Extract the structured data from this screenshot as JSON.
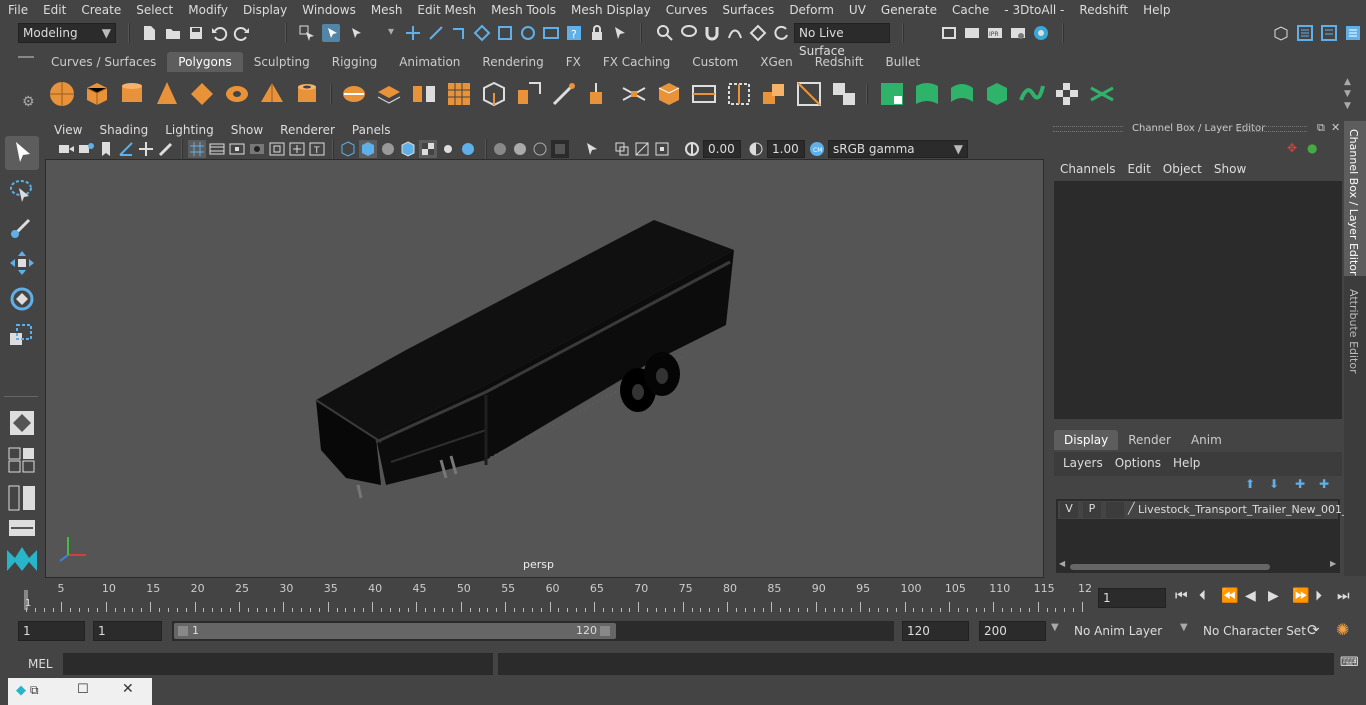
{
  "menubar": {
    "items": [
      "File",
      "Edit",
      "Create",
      "Select",
      "Modify",
      "Display",
      "Windows",
      "Mesh",
      "Edit Mesh",
      "Mesh Tools",
      "Mesh Display",
      "Curves",
      "Surfaces",
      "Deform",
      "UV",
      "Generate",
      "Cache",
      "- 3DtoAll -",
      "Redshift",
      "Help"
    ]
  },
  "status": {
    "mode": "Modeling",
    "live_surface": "No Live Surface"
  },
  "shelf": {
    "tabs": [
      "Curves / Surfaces",
      "Polygons",
      "Sculpting",
      "Rigging",
      "Animation",
      "Rendering",
      "FX",
      "FX Caching",
      "Custom",
      "XGen",
      "Redshift",
      "Bullet"
    ],
    "active_tab": "Polygons"
  },
  "viewport": {
    "menus": [
      "View",
      "Shading",
      "Lighting",
      "Show",
      "Renderer",
      "Panels"
    ],
    "exposure": "0.00",
    "gamma": "1.00",
    "color_space": "sRGB gamma",
    "camera_label": "persp"
  },
  "channel_box": {
    "title": "Channel Box / Layer Editor",
    "menus": [
      "Channels",
      "Edit",
      "Object",
      "Show"
    ],
    "layer_tabs": [
      "Display",
      "Render",
      "Anim"
    ],
    "active_layer_tab": "Display",
    "layer_menus": [
      "Layers",
      "Options",
      "Help"
    ],
    "layer": {
      "v": "V",
      "p": "P",
      "name": "Livestock_Transport_Trailer_New_001_"
    }
  },
  "side_tabs": [
    "Channel Box / Layer Editor",
    "Attribute Editor"
  ],
  "timeline": {
    "ticks": [
      "5",
      "10",
      "15",
      "20",
      "25",
      "30",
      "35",
      "40",
      "45",
      "50",
      "55",
      "60",
      "65",
      "70",
      "75",
      "80",
      "85",
      "90",
      "95",
      "100",
      "105",
      "110",
      "115",
      "12"
    ],
    "start_marker": "1",
    "current_frame": "1"
  },
  "range": {
    "start": "1",
    "anim_start": "1",
    "slider_start": "1",
    "slider_end": "120",
    "anim_end": "120",
    "end": "200",
    "anim_layer": "No Anim Layer",
    "character_set": "No Character Set"
  },
  "cmd": {
    "label": "MEL"
  }
}
